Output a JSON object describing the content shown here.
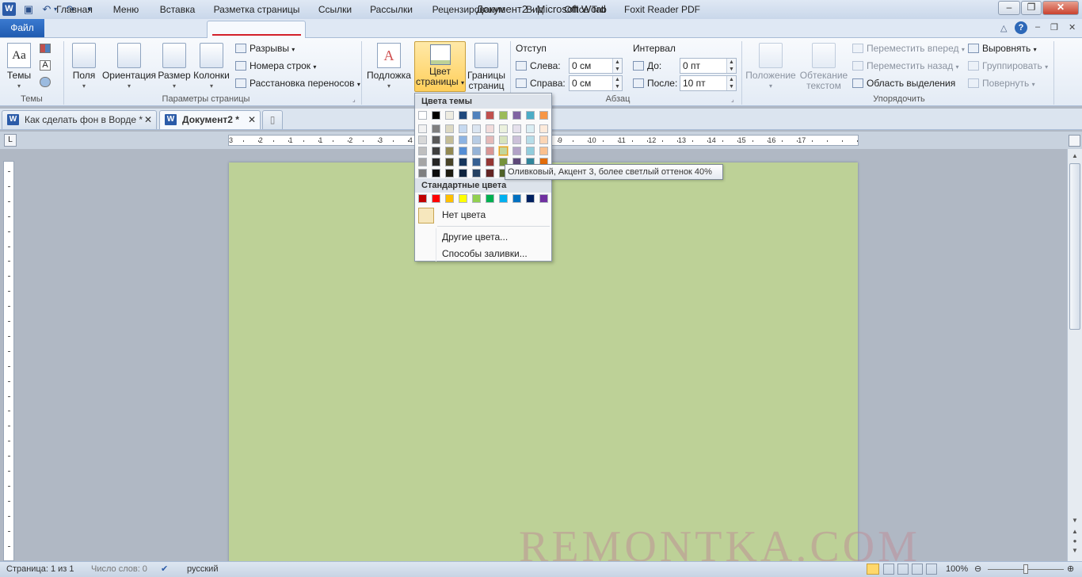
{
  "window": {
    "title": "Документ2 - Microsoft Word"
  },
  "tabs": {
    "file": "Файл",
    "items": [
      "Главная",
      "Меню",
      "Вставка",
      "Разметка страницы",
      "Ссылки",
      "Рассылки",
      "Рецензирование",
      "Вид",
      "Office Tab",
      "Foxit Reader PDF"
    ]
  },
  "ribbon": {
    "themes": {
      "label": "Темы",
      "group": "Темы"
    },
    "page_setup": {
      "group": "Параметры страницы",
      "fields": "Поля",
      "orientation": "Ориентация",
      "size": "Размер",
      "columns": "Колонки",
      "breaks": "Разрывы",
      "line_numbers": "Номера строк",
      "hyphenation": "Расстановка переносов"
    },
    "background": {
      "group_partial": "Фо",
      "watermark": "Подложка",
      "page_color_line1": "Цвет",
      "page_color_line2": "страницы",
      "page_borders_line1": "Границы",
      "page_borders_line2": "страниц"
    },
    "paragraph": {
      "group": "Абзац",
      "indent": "Отступ",
      "left": "Слева:",
      "right": "Справа:",
      "left_val": "0 см",
      "right_val": "0 см",
      "spacing": "Интервал",
      "before": "До:",
      "after": "После:",
      "before_val": "0 пт",
      "after_val": "10 пт"
    },
    "arrange": {
      "group": "Упорядочить",
      "position": "Положение",
      "wrap_line1": "Обтекание",
      "wrap_line2": "текстом",
      "bring_forward": "Переместить вперед",
      "send_backward": "Переместить назад",
      "selection_pane": "Область выделения",
      "align": "Выровнять",
      "group_btn": "Группировать",
      "rotate": "Повернуть"
    }
  },
  "doc_tabs": [
    "Как сделать фон в Ворде *",
    "Документ2 *"
  ],
  "dropdown": {
    "theme_header": "Цвета темы",
    "standard_header": "Стандартные цвета",
    "no_color": "Нет цвета",
    "more_colors": "Другие цвета...",
    "fill_effects": "Способы заливки...",
    "theme_row": [
      "#ffffff",
      "#000000",
      "#eeece1",
      "#1f497d",
      "#4f81bd",
      "#c0504d",
      "#9bbb59",
      "#8064a2",
      "#4bacc6",
      "#f79646"
    ],
    "theme_shades": [
      [
        "#f2f2f2",
        "#7f7f7f",
        "#ddd9c3",
        "#c6d9f0",
        "#dbe5f1",
        "#f2dcdb",
        "#ebf1dd",
        "#e5e0ec",
        "#dbeef3",
        "#fdeada"
      ],
      [
        "#d8d8d8",
        "#595959",
        "#c4bd97",
        "#8db3e2",
        "#b8cce4",
        "#e5b9b7",
        "#d7e3bc",
        "#ccc1d9",
        "#b7dde8",
        "#fbd5b5"
      ],
      [
        "#bfbfbf",
        "#3f3f3f",
        "#938953",
        "#548dd4",
        "#95b3d7",
        "#d99694",
        "#c3d69b",
        "#b2a2c7",
        "#92cddc",
        "#fac08f"
      ],
      [
        "#a5a5a5",
        "#262626",
        "#494429",
        "#17365d",
        "#366092",
        "#953734",
        "#76923c",
        "#5f497a",
        "#31859b",
        "#e36c09"
      ],
      [
        "#7f7f7f",
        "#0c0c0c",
        "#1d1b10",
        "#0f243e",
        "#244061",
        "#632423",
        "#4f6128",
        "#3f3151",
        "#205867",
        "#974806"
      ]
    ],
    "standard_row": [
      "#c00000",
      "#ff0000",
      "#ffc000",
      "#ffff00",
      "#92d050",
      "#00b050",
      "#00b0f0",
      "#0070c0",
      "#002060",
      "#7030a0"
    ]
  },
  "tooltip": "Оливковый, Акцент 3, более светлый оттенок 40%",
  "ruler_numbers": [
    "3",
    "2",
    "1",
    "1",
    "2",
    "3",
    "4",
    "5",
    "6",
    "7",
    "8",
    "9",
    "10",
    "11",
    "12",
    "13",
    "14",
    "15",
    "16",
    "17"
  ],
  "status": {
    "page": "Страница: 1 из 1",
    "words": "Число слов: 0",
    "language": "русский",
    "zoom": "100%"
  },
  "watermark": "REMONTKA.COM"
}
